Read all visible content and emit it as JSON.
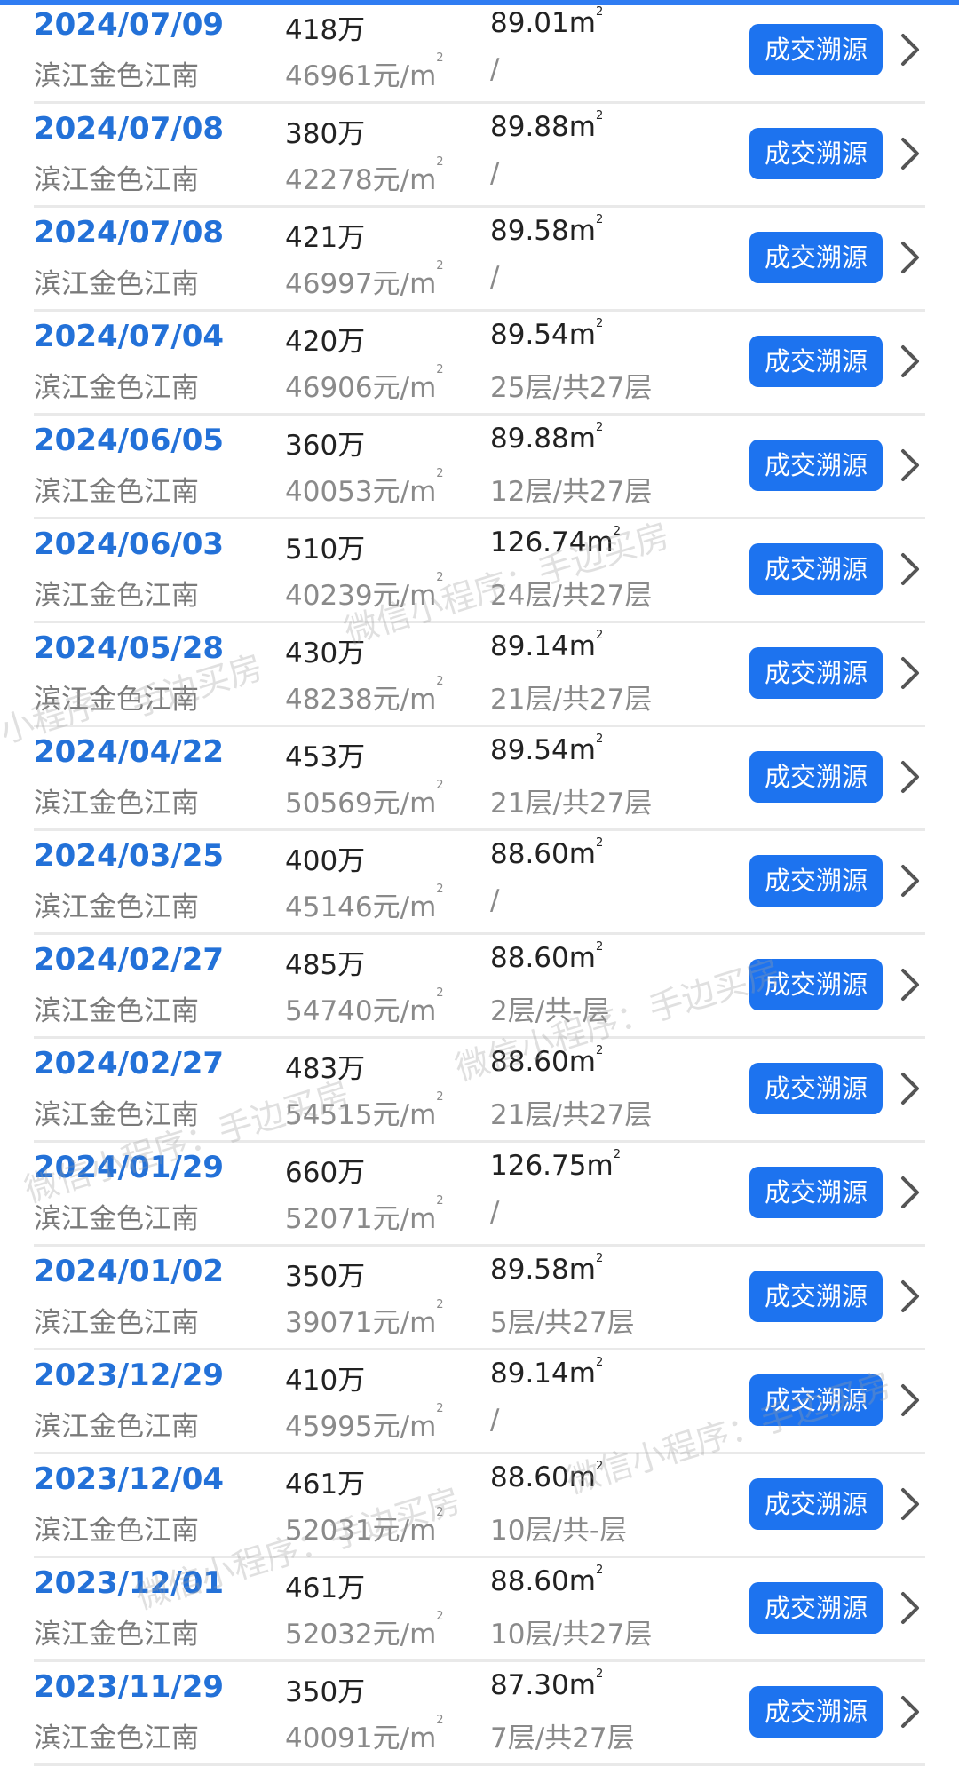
{
  "trace_label": "成交溯源",
  "area_unit": "m",
  "unit_price_suffix": "元/m",
  "records": [
    {
      "date": "2024/07/09",
      "community": "滨江金色江南",
      "price": "418万",
      "unit_price": "46961",
      "area": "89.01",
      "floor": "/"
    },
    {
      "date": "2024/07/08",
      "community": "滨江金色江南",
      "price": "380万",
      "unit_price": "42278",
      "area": "89.88",
      "floor": "/"
    },
    {
      "date": "2024/07/08",
      "community": "滨江金色江南",
      "price": "421万",
      "unit_price": "46997",
      "area": "89.58",
      "floor": "/"
    },
    {
      "date": "2024/07/04",
      "community": "滨江金色江南",
      "price": "420万",
      "unit_price": "46906",
      "area": "89.54",
      "floor": "25层/共27层"
    },
    {
      "date": "2024/06/05",
      "community": "滨江金色江南",
      "price": "360万",
      "unit_price": "40053",
      "area": "89.88",
      "floor": "12层/共27层"
    },
    {
      "date": "2024/06/03",
      "community": "滨江金色江南",
      "price": "510万",
      "unit_price": "40239",
      "area": "126.74",
      "floor": "24层/共27层"
    },
    {
      "date": "2024/05/28",
      "community": "滨江金色江南",
      "price": "430万",
      "unit_price": "48238",
      "area": "89.14",
      "floor": "21层/共27层"
    },
    {
      "date": "2024/04/22",
      "community": "滨江金色江南",
      "price": "453万",
      "unit_price": "50569",
      "area": "89.54",
      "floor": "21层/共27层"
    },
    {
      "date": "2024/03/25",
      "community": "滨江金色江南",
      "price": "400万",
      "unit_price": "45146",
      "area": "88.60",
      "floor": "/"
    },
    {
      "date": "2024/02/27",
      "community": "滨江金色江南",
      "price": "485万",
      "unit_price": "54740",
      "area": "88.60",
      "floor": "2层/共-层"
    },
    {
      "date": "2024/02/27",
      "community": "滨江金色江南",
      "price": "483万",
      "unit_price": "54515",
      "area": "88.60",
      "floor": "21层/共27层"
    },
    {
      "date": "2024/01/29",
      "community": "滨江金色江南",
      "price": "660万",
      "unit_price": "52071",
      "area": "126.75",
      "floor": "/"
    },
    {
      "date": "2024/01/02",
      "community": "滨江金色江南",
      "price": "350万",
      "unit_price": "39071",
      "area": "89.58",
      "floor": "5层/共27层"
    },
    {
      "date": "2023/12/29",
      "community": "滨江金色江南",
      "price": "410万",
      "unit_price": "45995",
      "area": "89.14",
      "floor": "/"
    },
    {
      "date": "2023/12/04",
      "community": "滨江金色江南",
      "price": "461万",
      "unit_price": "52031",
      "area": "88.60",
      "floor": "10层/共-层"
    },
    {
      "date": "2023/12/01",
      "community": "滨江金色江南",
      "price": "461万",
      "unit_price": "52032",
      "area": "88.60",
      "floor": "10层/共27层"
    },
    {
      "date": "2023/11/29",
      "community": "滨江金色江南",
      "price": "350万",
      "unit_price": "40091",
      "area": "87.30",
      "floor": "7层/共27层"
    }
  ],
  "watermark_texts": [
    "微信小程序：手边买房",
    "手边买房",
    "小程序",
    "微信小程序：手边买房",
    "微信小程序：手边买房",
    "微信小程序：手边买房",
    "微信小程序：手边买房"
  ],
  "colors": {
    "accent": "#2f7cf2",
    "date": "#2371d8",
    "button": "#1d73ef"
  },
  "icons": {
    "row_chevron": "chevron-right-icon"
  }
}
